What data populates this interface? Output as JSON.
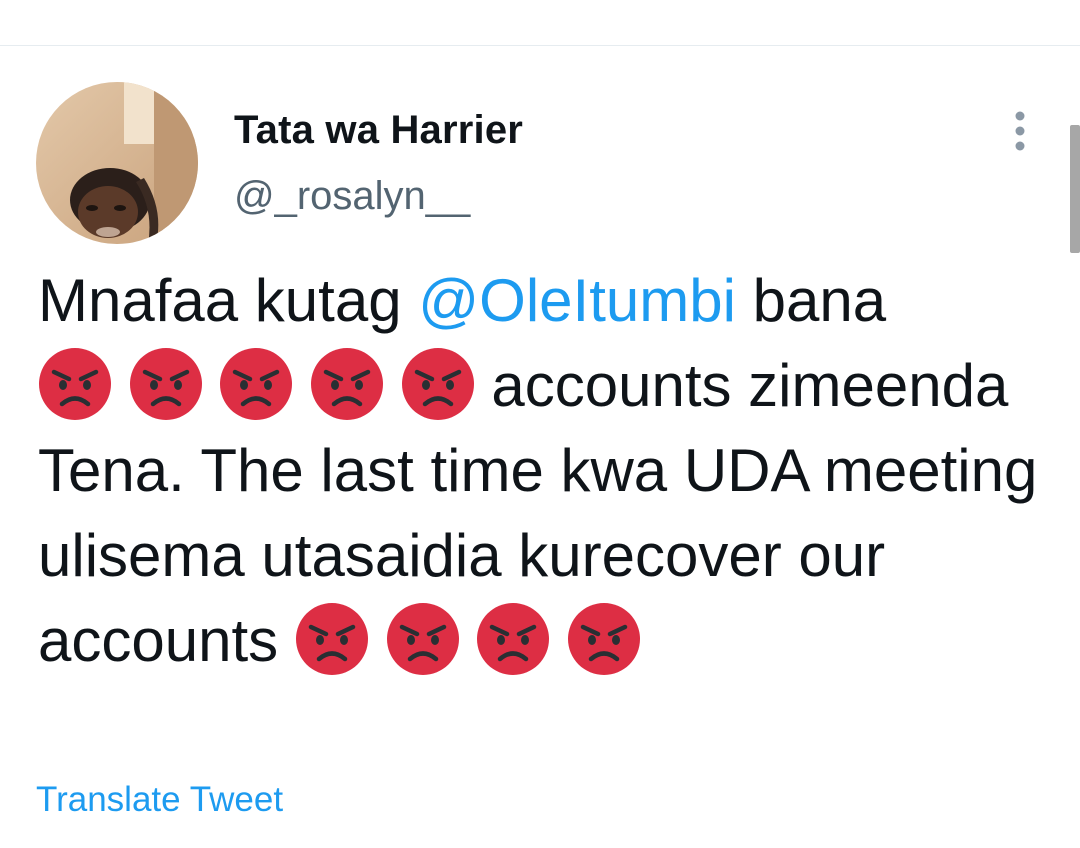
{
  "tweet": {
    "display_name": "Tata wa Harrier",
    "handle": "@_rosalyn__",
    "text_line1_part1": "Mnafaa kutag ",
    "mention": "@OleItumbi",
    "text_line1_part2": "  bana",
    "text_after_emojis": "accounts zimeenda Tena. The last time kwa UDA meeting ulisema utasaidia kurecover our accounts",
    "emoji_name": "angry-face-icon",
    "translate_label": "Translate Tweet"
  },
  "colors": {
    "link": "#1d9bf0",
    "text": "#0f1419",
    "secondary_text": "#536471",
    "emoji_red": "#dd2e44"
  }
}
